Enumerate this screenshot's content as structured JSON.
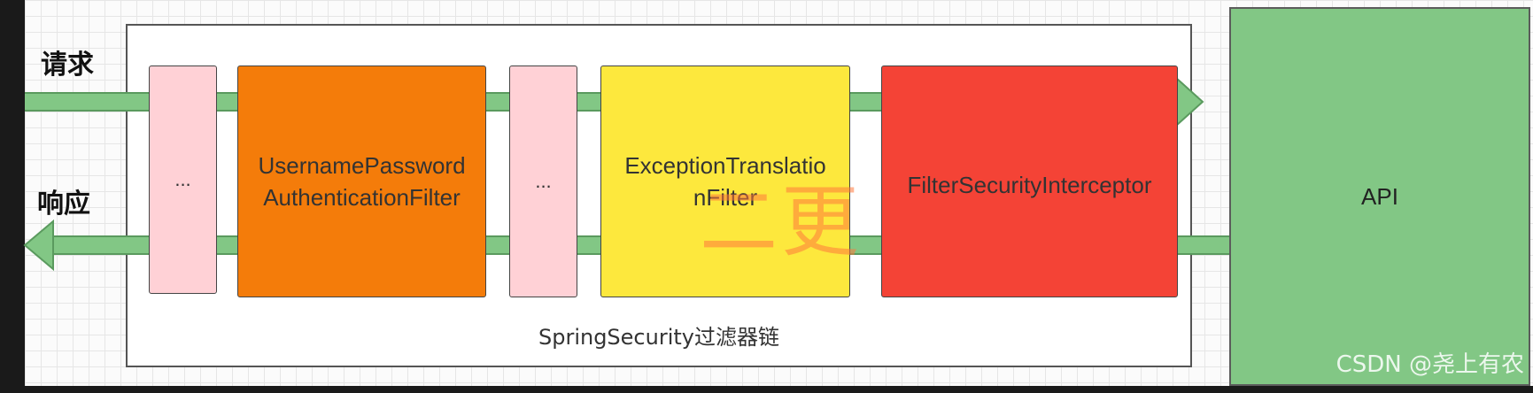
{
  "labels": {
    "request": "请求",
    "response": "响应"
  },
  "chain": {
    "label": "SpringSecurity过滤器链"
  },
  "filters": [
    {
      "id": "ellipsis-1",
      "text": "...",
      "color": "#ffd1d6"
    },
    {
      "id": "username-password",
      "line1": "UsernamePassword",
      "line2": "AuthenticationFilter",
      "color": "#f47c0a"
    },
    {
      "id": "ellipsis-2",
      "text": "...",
      "color": "#ffd1d6"
    },
    {
      "id": "exception-translation",
      "line1": "ExceptionTranslatio",
      "line2": "nFilter",
      "color": "#fde83d"
    },
    {
      "id": "filter-security-interceptor",
      "text": "FilterSecurityInterceptor",
      "color": "#f44336"
    }
  ],
  "api": {
    "label": "API",
    "color": "#82c785"
  },
  "watermark": "二更",
  "credit": "CSDN @尧上有农"
}
